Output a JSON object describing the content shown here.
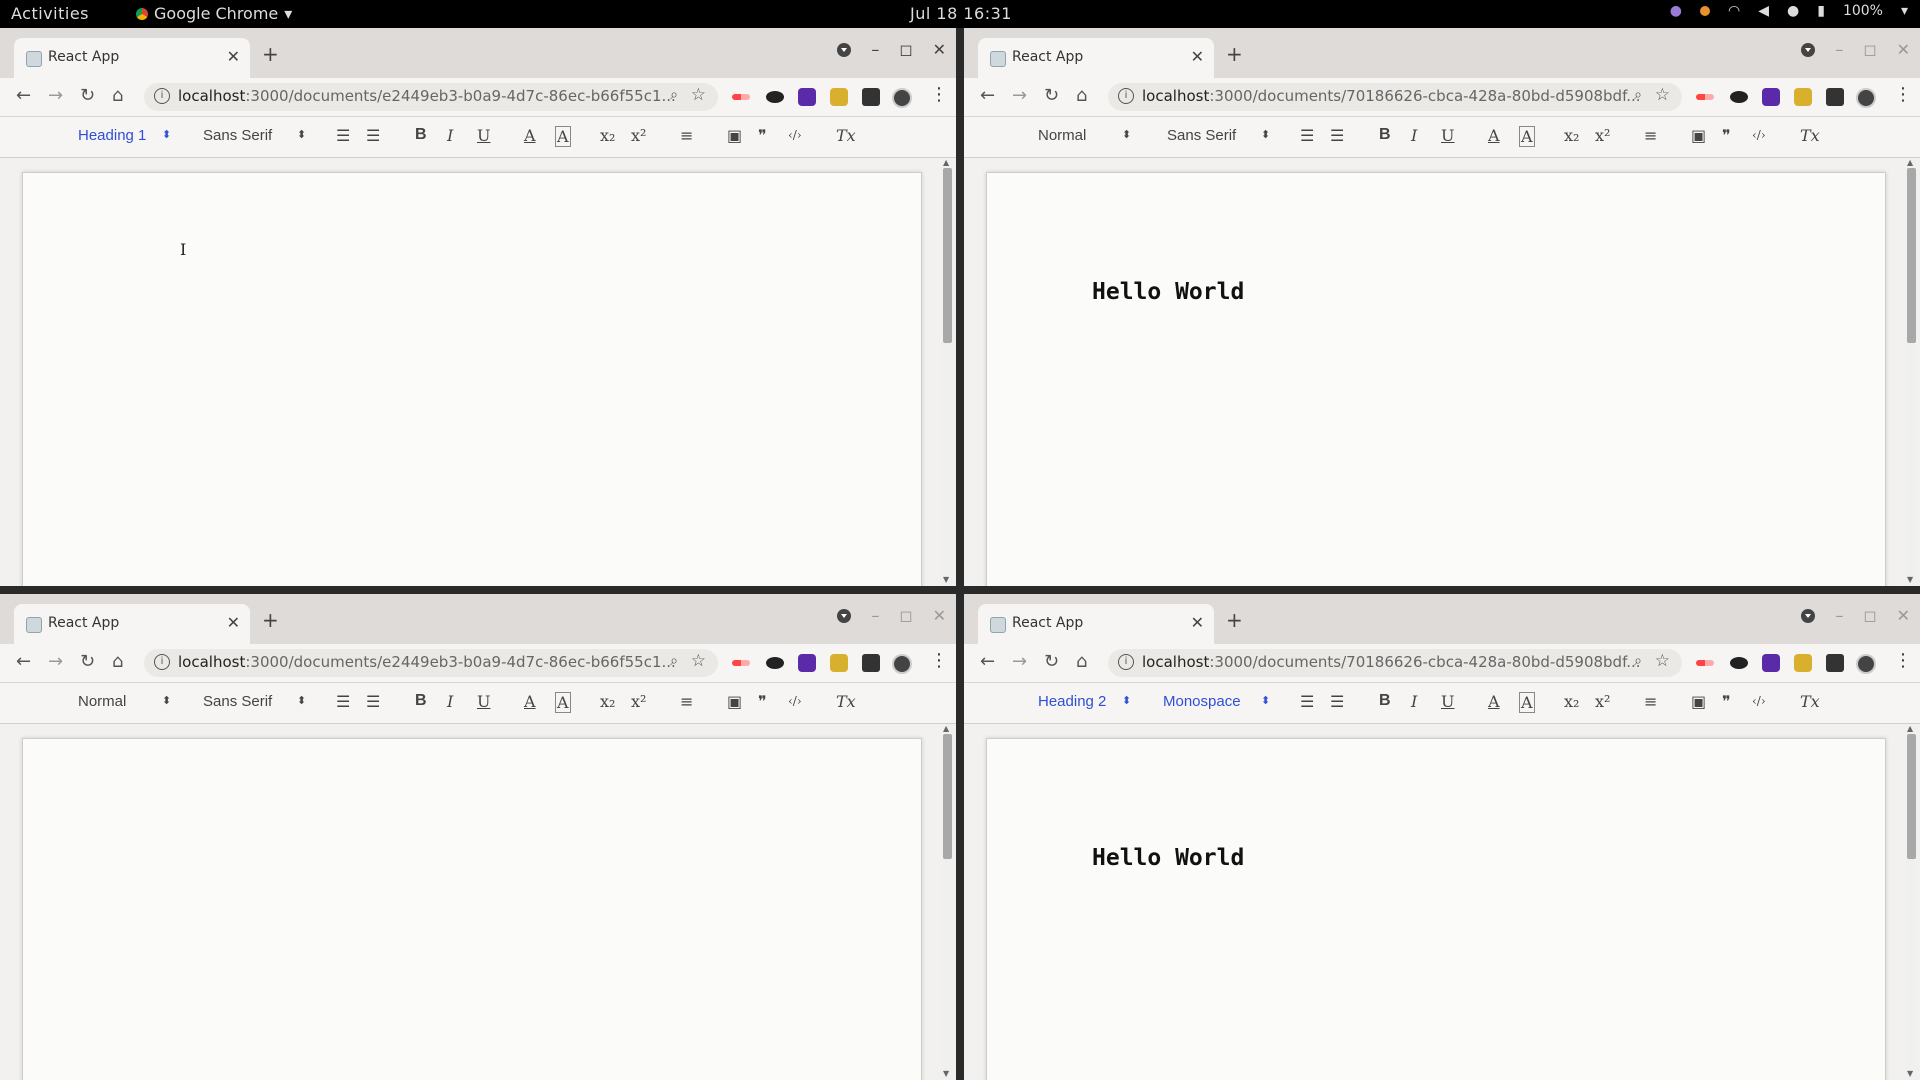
{
  "topbar": {
    "activities": "Activities",
    "app": "Google Chrome",
    "clock": "Jul 18  16:31",
    "battery": "100%"
  },
  "windows": [
    {
      "tab_title": "React App",
      "url_host": "localhost",
      "url_path": ":3000/documents/e2449eb3-b0a9-4d7c-86ec-b66f55c1...",
      "format": "Heading 1",
      "font": "Sans Serif",
      "format_active": true,
      "font_active": false,
      "content": ""
    },
    {
      "tab_title": "React App",
      "url_host": "localhost",
      "url_path": ":3000/documents/70186626-cbca-428a-80bd-d5908bdf...",
      "format": "Normal",
      "font": "Sans Serif",
      "format_active": false,
      "font_active": false,
      "content": "Hello World"
    },
    {
      "tab_title": "React App",
      "url_host": "localhost",
      "url_path": ":3000/documents/e2449eb3-b0a9-4d7c-86ec-b66f55c1...",
      "format": "Normal",
      "font": "Sans Serif",
      "format_active": false,
      "font_active": false,
      "content": ""
    },
    {
      "tab_title": "React App",
      "url_host": "localhost",
      "url_path": ":3000/documents/70186626-cbca-428a-80bd-d5908bdf...",
      "format": "Heading 2",
      "font": "Monospace",
      "format_active": true,
      "font_active": true,
      "content": "Hello World"
    }
  ],
  "toolbar_icons": {
    "ordered_list": "☰",
    "bullet_list": "☰",
    "bold": "B",
    "italic": "I",
    "underline": "U",
    "text_color": "A",
    "background": "A",
    "subscript": "x₂",
    "superscript": "x²",
    "align": "≡",
    "image": "▣",
    "blockquote": "❞",
    "code": "‹/›",
    "clean": "Tx"
  },
  "colors": {
    "active": "#2f4fd6",
    "toolbar_text": "#444444"
  }
}
